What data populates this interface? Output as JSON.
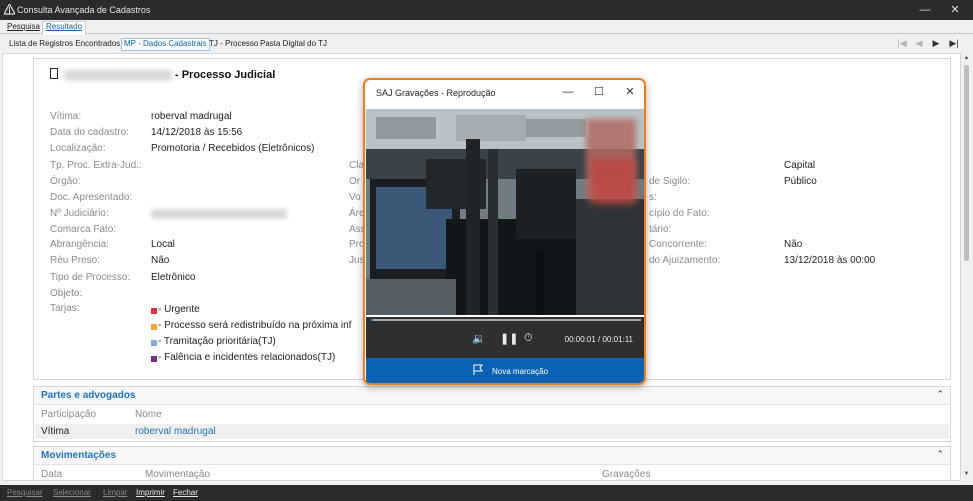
{
  "window": {
    "title": "Consulta Avançada de Cadastros"
  },
  "main_tabs": [
    {
      "label": "Pesquisa"
    },
    {
      "label": "Resultado"
    }
  ],
  "sub_tabs": [
    {
      "label": "Lista de Registros Encontrados"
    },
    {
      "label": "MP - Dados Cadastrais"
    },
    {
      "label": "TJ - Processo"
    },
    {
      "label": "Pasta Digital do TJ"
    }
  ],
  "record": {
    "heading": "- Processo Judicial",
    "fields": {
      "vitima": {
        "label": "Vítima:",
        "value": "roberval madrugal"
      },
      "data_cadastro": {
        "label": "Data do cadastro:",
        "value": "14/12/2018 às 15:56"
      },
      "localizacao": {
        "label": "Localização:",
        "value": "Promotoria / Recebidos (Eletrônicos)"
      },
      "tp_proc": {
        "label": "Tp. Proc. Extra-Jud.:"
      },
      "orgao": {
        "label": "Órgão:"
      },
      "doc_apresentado": {
        "label": "Doc. Apresentado:"
      },
      "n_judiciario": {
        "label": "Nº Judiciário:"
      },
      "comarca_fato": {
        "label": "Comarca Fato:"
      },
      "abrangencia": {
        "label": "Abrangência:",
        "value": "Local"
      },
      "reu_preso": {
        "label": "Réu Preso:",
        "value": "Não"
      },
      "tipo_processo": {
        "label": "Tipo de Processo:",
        "value": "Eletrônico"
      },
      "objeto": {
        "label": "Objeto:"
      },
      "tarjas": {
        "label": "Tarjas:"
      }
    },
    "tarjas": [
      {
        "text": "- Urgente",
        "color": "#d9343b"
      },
      {
        "text": "- Processo será redistribuído na próxima inf",
        "color": "#f2a531"
      },
      {
        "text": "- Tramitação prioritária(TJ)",
        "color": "#7ea9d8"
      },
      {
        "text": "- Falência e incidentes relacionados(TJ)",
        "color": "#7a2a8c"
      }
    ],
    "mid_fragments": [
      "Cla",
      "Or",
      "Vo",
      "Áre",
      "Ass",
      "Pro",
      "Jus"
    ],
    "right_labels": [
      "de Sigilo:",
      "s:",
      "cípio do Fato:",
      "tário:",
      "Concorrente:",
      "do Ajuizamento:"
    ],
    "right_values": {
      "capital": "Capital",
      "publico": "Público",
      "nao": "Não",
      "ajuizamento": "13/12/2018 às 00:00"
    }
  },
  "partes": {
    "title": "Partes e advogados",
    "col_participacao": "Participação",
    "col_nome": "Nome",
    "row_participacao": "Vítima",
    "row_nome": "roberval madrugal"
  },
  "movimentacoes": {
    "title": "Movimentações",
    "col_data": "Data",
    "col_mov": "Movimentação",
    "col_grav": "Gravações"
  },
  "bottom_toolbar": {
    "pesquisar": "Pesquisar",
    "selecionar": "Selecionar",
    "limpar": "Limpar",
    "imprimir": "Imprimir",
    "fechar": "Fechar"
  },
  "player": {
    "title": "SAJ Gravações - Reprodução",
    "time": "00:00:01 / 00:01:11",
    "progress": 0.01,
    "marker_label": "Nova marcação"
  }
}
